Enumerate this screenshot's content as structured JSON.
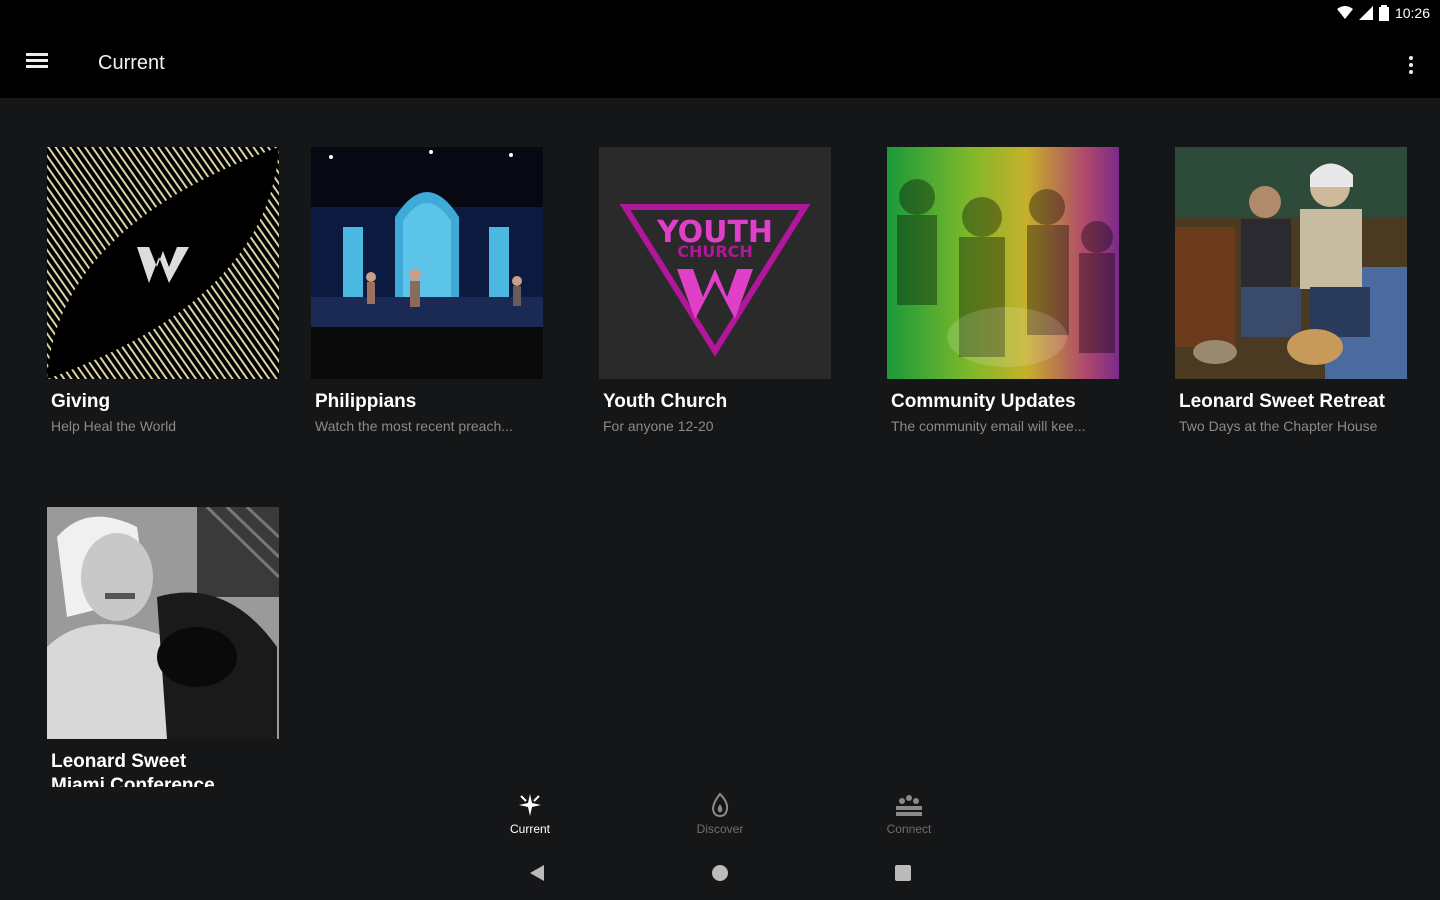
{
  "status_bar": {
    "time": "10:26"
  },
  "app_bar": {
    "title": "Current"
  },
  "cards": [
    {
      "title": "Giving",
      "subtitle": "Help Heal the World"
    },
    {
      "title": "Philippians",
      "subtitle": "Watch the most recent preach..."
    },
    {
      "title": "Youth Church",
      "subtitle": "For anyone 12-20",
      "logo_line1": "YOUTH",
      "logo_line2": "CHURCH"
    },
    {
      "title": "Community Updates",
      "subtitle": "The community email will kee..."
    },
    {
      "title": "Leonard Sweet Retreat",
      "subtitle": "Two Days at the Chapter House"
    },
    {
      "title": "Leonard Sweet",
      "subtitle": "Miami Conference"
    }
  ],
  "bottom_nav": [
    {
      "label": "Current",
      "icon": "sparkle-icon",
      "active": true
    },
    {
      "label": "Discover",
      "icon": "flame-icon",
      "active": false
    },
    {
      "label": "Connect",
      "icon": "people-icon",
      "active": false
    }
  ],
  "colors": {
    "background": "#151618",
    "bar": "#000000",
    "youth_accent": "#e040c8"
  }
}
